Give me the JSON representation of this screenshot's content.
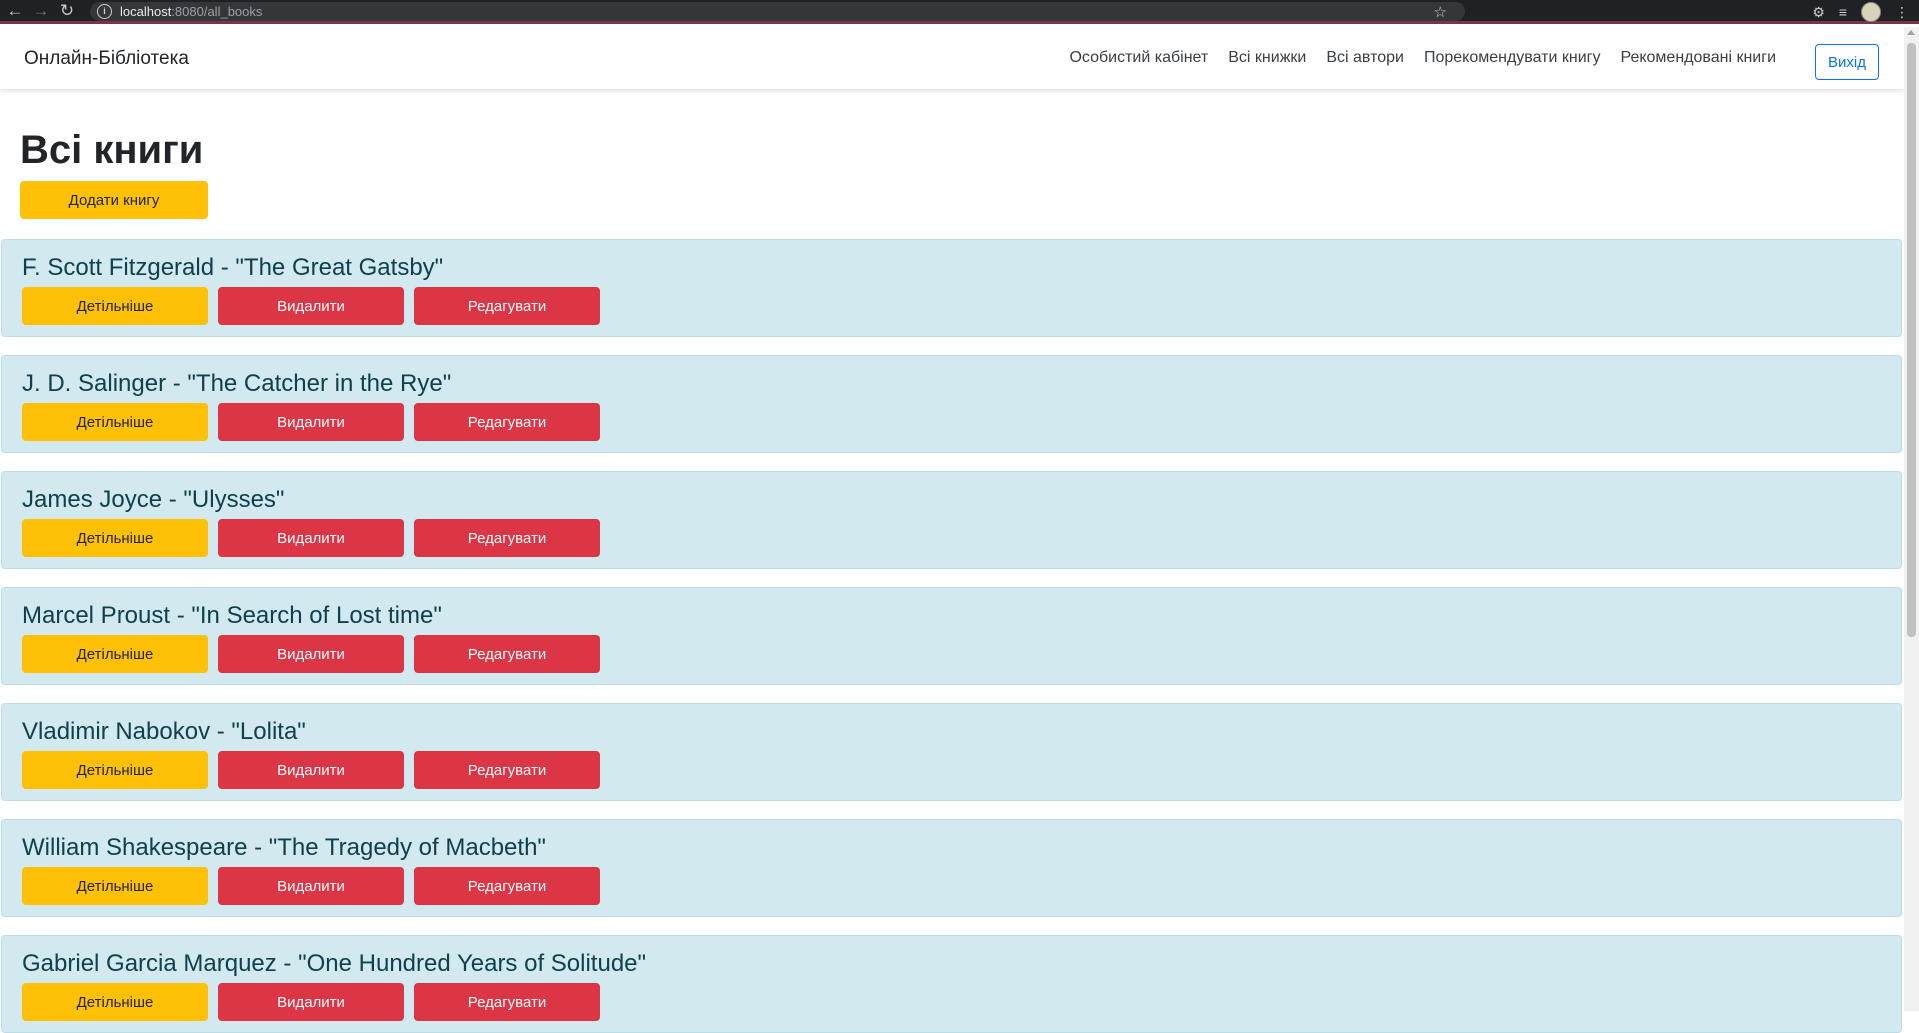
{
  "browser": {
    "url_host": "localhost",
    "url_path": ":8080/all_books"
  },
  "navbar": {
    "brand": "Онлайн-Бібліотека",
    "links": [
      "Особистий кабінет",
      "Всі книжки",
      "Всі автори",
      "Порекомендувати книгу",
      "Рекомендовані книги"
    ],
    "logout_label": "Вихід"
  },
  "page": {
    "title": "Всі книги",
    "add_button_label": "Додати книгу"
  },
  "books": [
    {
      "title": "F. Scott Fitzgerald - \"The Great Gatsby\""
    },
    {
      "title": "J. D. Salinger - \"The Catcher in the Rye\""
    },
    {
      "title": "James Joyce - \"Ulysses\""
    },
    {
      "title": "Marcel Proust - \"In Search of Lost time\""
    },
    {
      "title": "Vladimir Nabokov - \"Lolita\""
    },
    {
      "title": "William Shakespeare - \"The Tragedy of Macbeth\""
    },
    {
      "title": "Gabriel Garcia Marquez - \"One Hundred Years of Solitude\""
    }
  ],
  "book_actions": {
    "details_label": "Детільніше",
    "delete_label": "Видалити",
    "edit_label": "Редагувати"
  },
  "colors": {
    "warning": "#ffc107",
    "danger": "#dc3545",
    "card_bg": "#d1e9ef",
    "primary": "#0d6efd"
  }
}
